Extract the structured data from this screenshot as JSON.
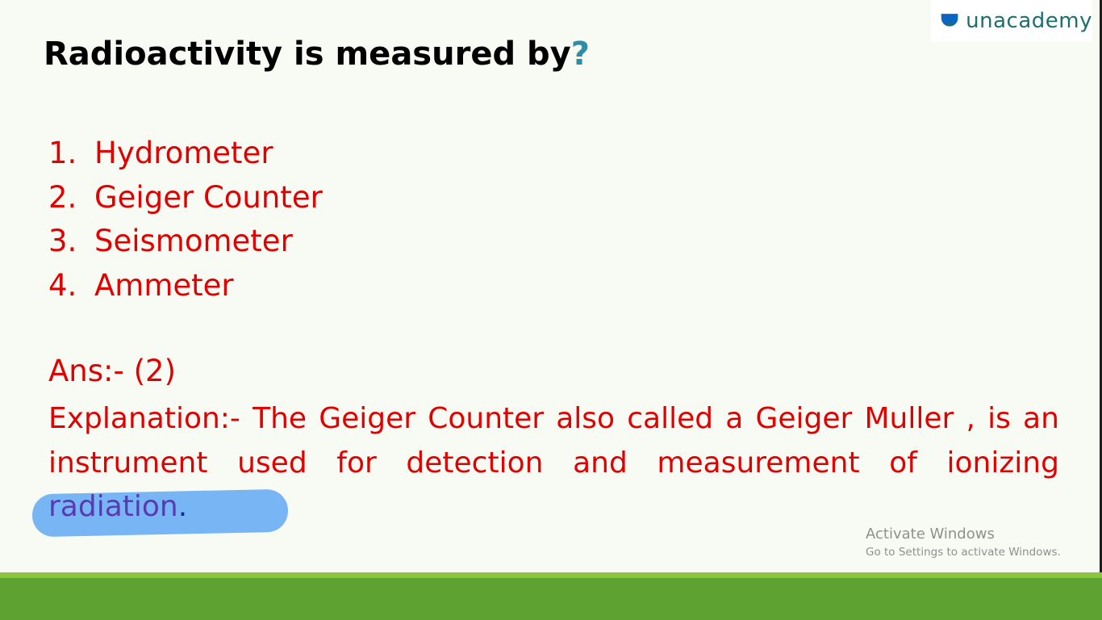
{
  "logo": {
    "text": "unacademy",
    "icon": "unacademy-logo-icon",
    "color": "#1d6f6e"
  },
  "question": {
    "text": "Radioactivity is measured by",
    "mark": "?"
  },
  "options": [
    {
      "number": "1.",
      "label": "Hydrometer"
    },
    {
      "number": "2.",
      "label": "Geiger Counter"
    },
    {
      "number": "3.",
      "label": "Seismometer"
    },
    {
      "number": "4.",
      "label": "Ammeter"
    }
  ],
  "answer": "Ans:- (2)",
  "explanation": {
    "line1": [
      "Explanation:-",
      "The",
      "Geiger",
      "Counter",
      "also",
      "called",
      "a",
      "Geiger",
      "Muller",
      ",",
      "is",
      "an"
    ],
    "line2": [
      "instrument",
      "used",
      "for",
      "detection",
      "and",
      "measurement",
      "of",
      "ionizing"
    ],
    "last_word": "radiation",
    "period": "."
  },
  "watermark": {
    "title": "Activate Windows",
    "subtitle": "Go to Settings to activate Windows."
  },
  "colors": {
    "text_red": "#e00000",
    "question_mark": "#2a8fa6",
    "highlight": "#5aa5f5",
    "stripe_light": "#8cc63f",
    "stripe_dark": "#5ea232"
  }
}
